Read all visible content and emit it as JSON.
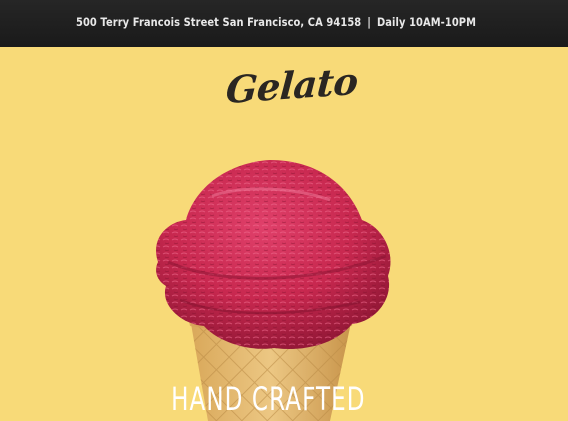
{
  "header": {
    "address": "500 Terry Francois Street San Francisco, CA 94158",
    "separator": "|",
    "hours": "Daily 10AM-10PM"
  },
  "brand": {
    "logo_text": "Gelato"
  },
  "hero": {
    "image_icon": "gelato-cone-image",
    "headline": "HAND CRAFTED"
  },
  "colors": {
    "background": "#f8da78",
    "topbar": "#1f1f1f",
    "gelato": "#c8284f",
    "cone": "#e2b768"
  }
}
